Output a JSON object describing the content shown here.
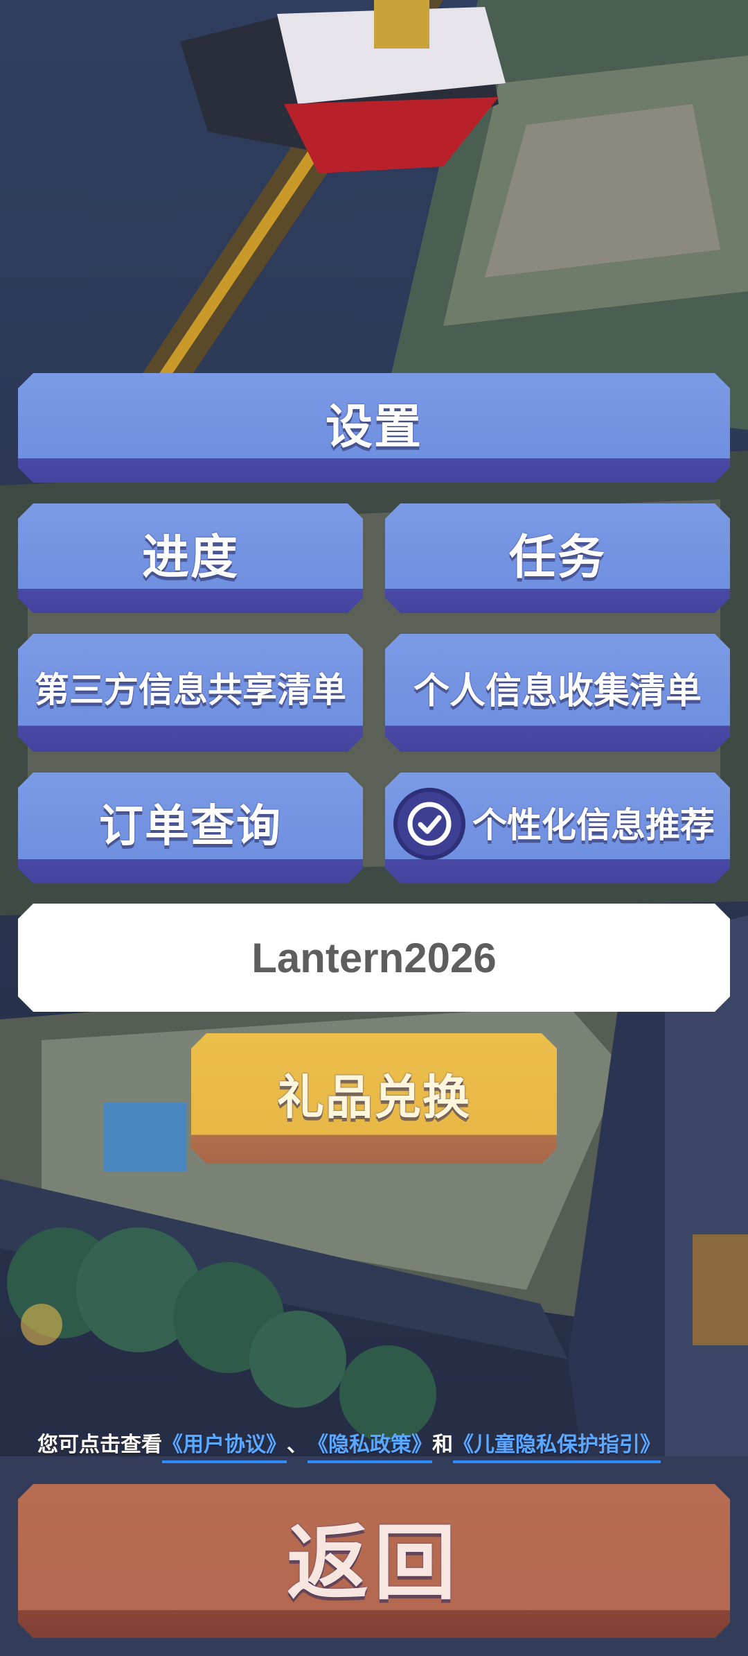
{
  "menu": {
    "settings": "设置",
    "progress": "进度",
    "tasks": "任务",
    "third_party_list": "第三方信息共享清单",
    "personal_info_list": "个人信息收集清单",
    "order_query": "订单查询",
    "personalized_recommendation": {
      "label": "个性化信息推荐",
      "checked": true,
      "icon": "check-circle-icon"
    }
  },
  "redeem": {
    "code_value": "Lantern2026",
    "button": "礼品兑换"
  },
  "agreement": {
    "prefix": "您可点击查看",
    "user_agreement": "《用户协议》",
    "separator": "、",
    "privacy_policy": "《隐私政策》",
    "and": "和",
    "children_privacy": "《儿童隐私保护指引》"
  },
  "back_button": "返回",
  "colors": {
    "menu_blue": "#6f8fe0",
    "gift_gold": "#e8b847",
    "back_brick": "#b3684f",
    "link_blue": "#5aa8ff"
  }
}
